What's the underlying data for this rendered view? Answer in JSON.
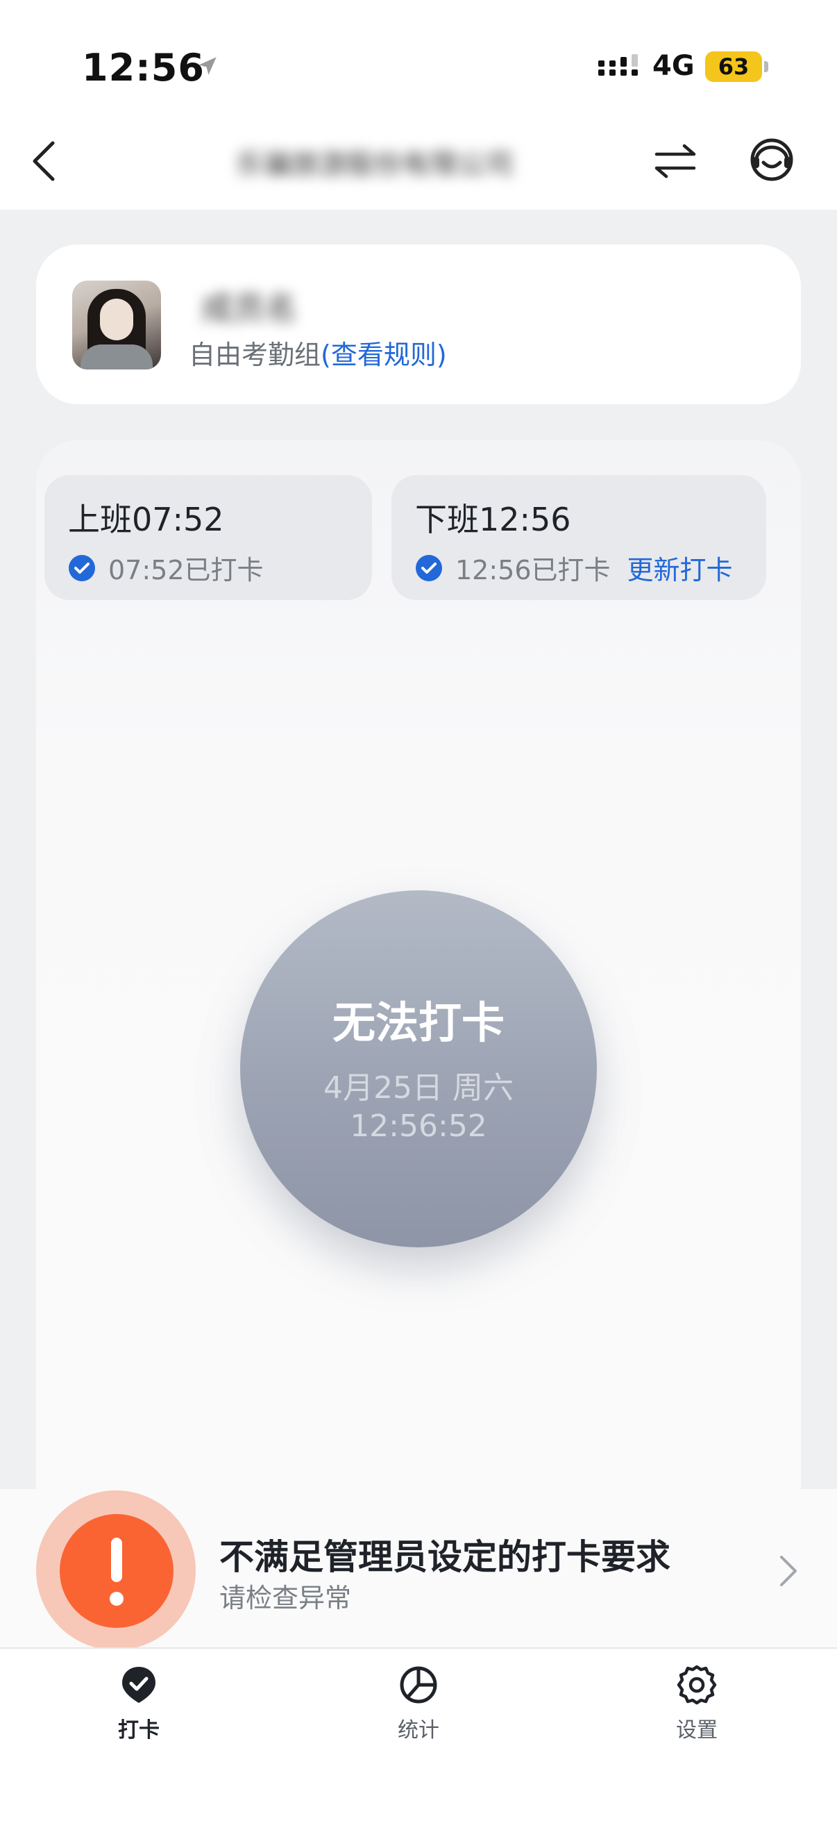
{
  "status_bar": {
    "time": "12:56",
    "network": "4G",
    "battery": "63",
    "icons": [
      "location-arrow-icon",
      "signal-icon",
      "battery-icon"
    ]
  },
  "nav": {
    "company_name": "乐骗旅游股份有限公司",
    "icons": [
      "back-icon",
      "switch-icon",
      "customer-service-icon"
    ]
  },
  "profile": {
    "name": "成员名",
    "group_label": "自由考勤组",
    "rule_link": "(查看规则)"
  },
  "shifts": [
    {
      "title": "上班07:52",
      "status": "07:52已打卡"
    },
    {
      "title": "下班12:56",
      "status": "12:56已打卡",
      "action": "更新打卡"
    }
  ],
  "clock_button": {
    "title": "无法打卡",
    "date": "4月25日 周六",
    "time": "12:56:52"
  },
  "alert": {
    "title": "不满足管理员设定的打卡要求",
    "subtitle": "请检查异常",
    "color": "#fa6433"
  },
  "tabs": [
    {
      "label": "打卡",
      "icon": "check-pin-icon",
      "active": true
    },
    {
      "label": "统计",
      "icon": "pie-chart-icon",
      "active": false
    },
    {
      "label": "设置",
      "icon": "gear-icon",
      "active": false
    }
  ],
  "colors": {
    "link": "#2268d8",
    "check": "#2268d8",
    "button_gray": "#9ca3b3"
  }
}
